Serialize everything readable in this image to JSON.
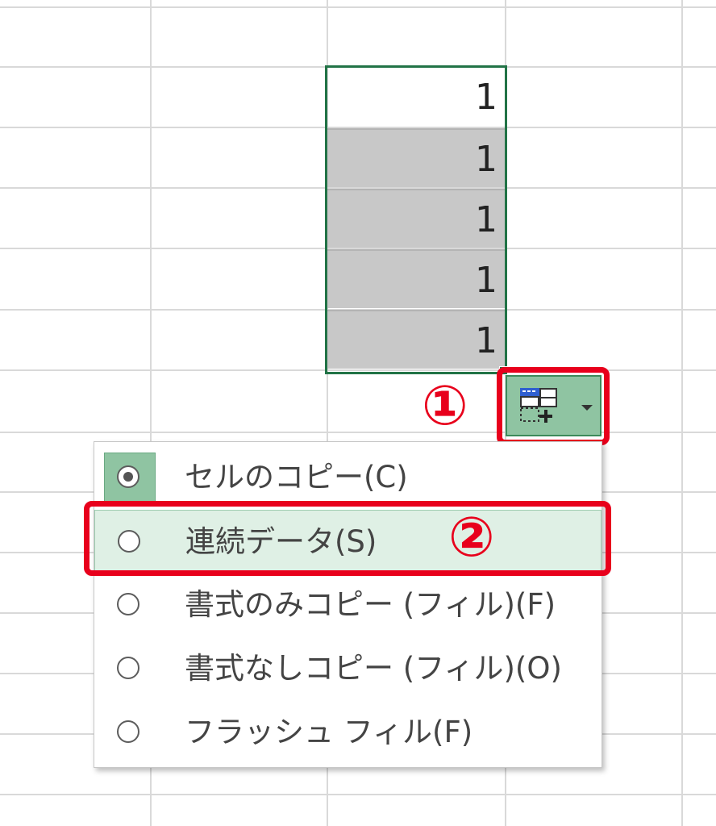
{
  "sheet": {
    "cells": [
      "1",
      "1",
      "1",
      "1",
      "1"
    ]
  },
  "autofill": {
    "button_icon": "autofill-options-icon",
    "dropdown_icon": "caret-down-icon",
    "menu": {
      "items": [
        {
          "label": "セルのコピー(C)",
          "selected": true
        },
        {
          "label": "連続データ(S)",
          "selected": false,
          "highlighted": true
        },
        {
          "label": "書式のみコピー (フィル)(F)",
          "selected": false
        },
        {
          "label": "書式なしコピー (フィル)(O)",
          "selected": false
        },
        {
          "label": "フラッシュ フィル(F)",
          "selected": false
        }
      ]
    }
  },
  "annotations": {
    "step1": "①",
    "step2": "②",
    "color": "#e8001c"
  },
  "colors": {
    "selection_border": "#217346",
    "button_bg": "#8fc4a2",
    "highlight_bg": "#dff0e5",
    "selected_cell_bg": "#c8c8c8"
  }
}
